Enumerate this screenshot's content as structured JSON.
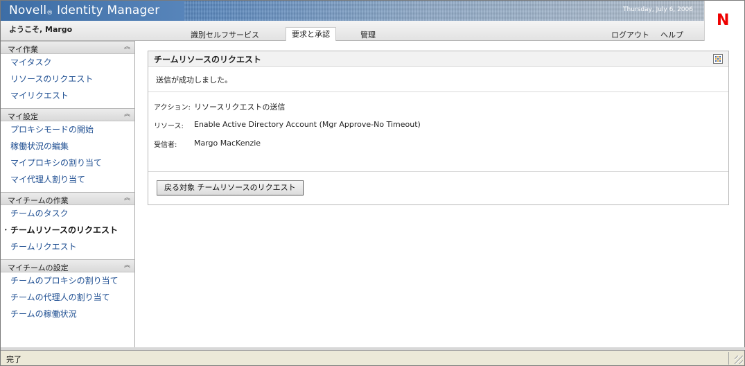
{
  "header": {
    "brand": "Novell",
    "brand_mark": "®",
    "product": "Identity Manager",
    "date": "Thursday, July 6, 2006",
    "logo_letter": "N"
  },
  "nav": {
    "welcome": "ようこそ, Margo",
    "tabs": [
      {
        "label": "識別セルフサービス",
        "active": false
      },
      {
        "label": "要求と承認",
        "active": true
      },
      {
        "label": "管理",
        "active": false
      }
    ],
    "logout": "ログアウト",
    "help": "ヘルプ"
  },
  "sidebar": {
    "sections": [
      {
        "title": "マイ作業",
        "items": [
          "マイタスク",
          "リソースのリクエスト",
          "マイリクエスト"
        ]
      },
      {
        "title": "マイ設定",
        "items": [
          "プロキシモードの開始",
          "稼働状況の編集",
          "マイプロキシの割り当て",
          "マイ代理人割り当て"
        ]
      },
      {
        "title": "マイチームの作業",
        "items": [
          "チームのタスク",
          "チームリソースのリクエスト",
          "チームリクエスト"
        ],
        "current_index": 1
      },
      {
        "title": "マイチームの設定",
        "items": [
          "チームのプロキシの割り当て",
          "チームの代理人の割り当て",
          "チームの稼働状況"
        ]
      }
    ],
    "collapse_icon": "chevron-up-double-icon"
  },
  "main": {
    "title": "チームリソースのリクエスト",
    "success_message": "送信が成功しました。",
    "details": [
      {
        "key": "アクション:",
        "value": "リソースリクエストの送信"
      },
      {
        "key": "リソース:",
        "value": "Enable Active Directory Account (Mgr Approve-No Timeout)"
      },
      {
        "key": "受信者:",
        "value": "Margo MacKenzie"
      }
    ],
    "back_button": "戻る対象 チームリソースのリクエスト"
  },
  "status_bar": {
    "text": "完了"
  }
}
